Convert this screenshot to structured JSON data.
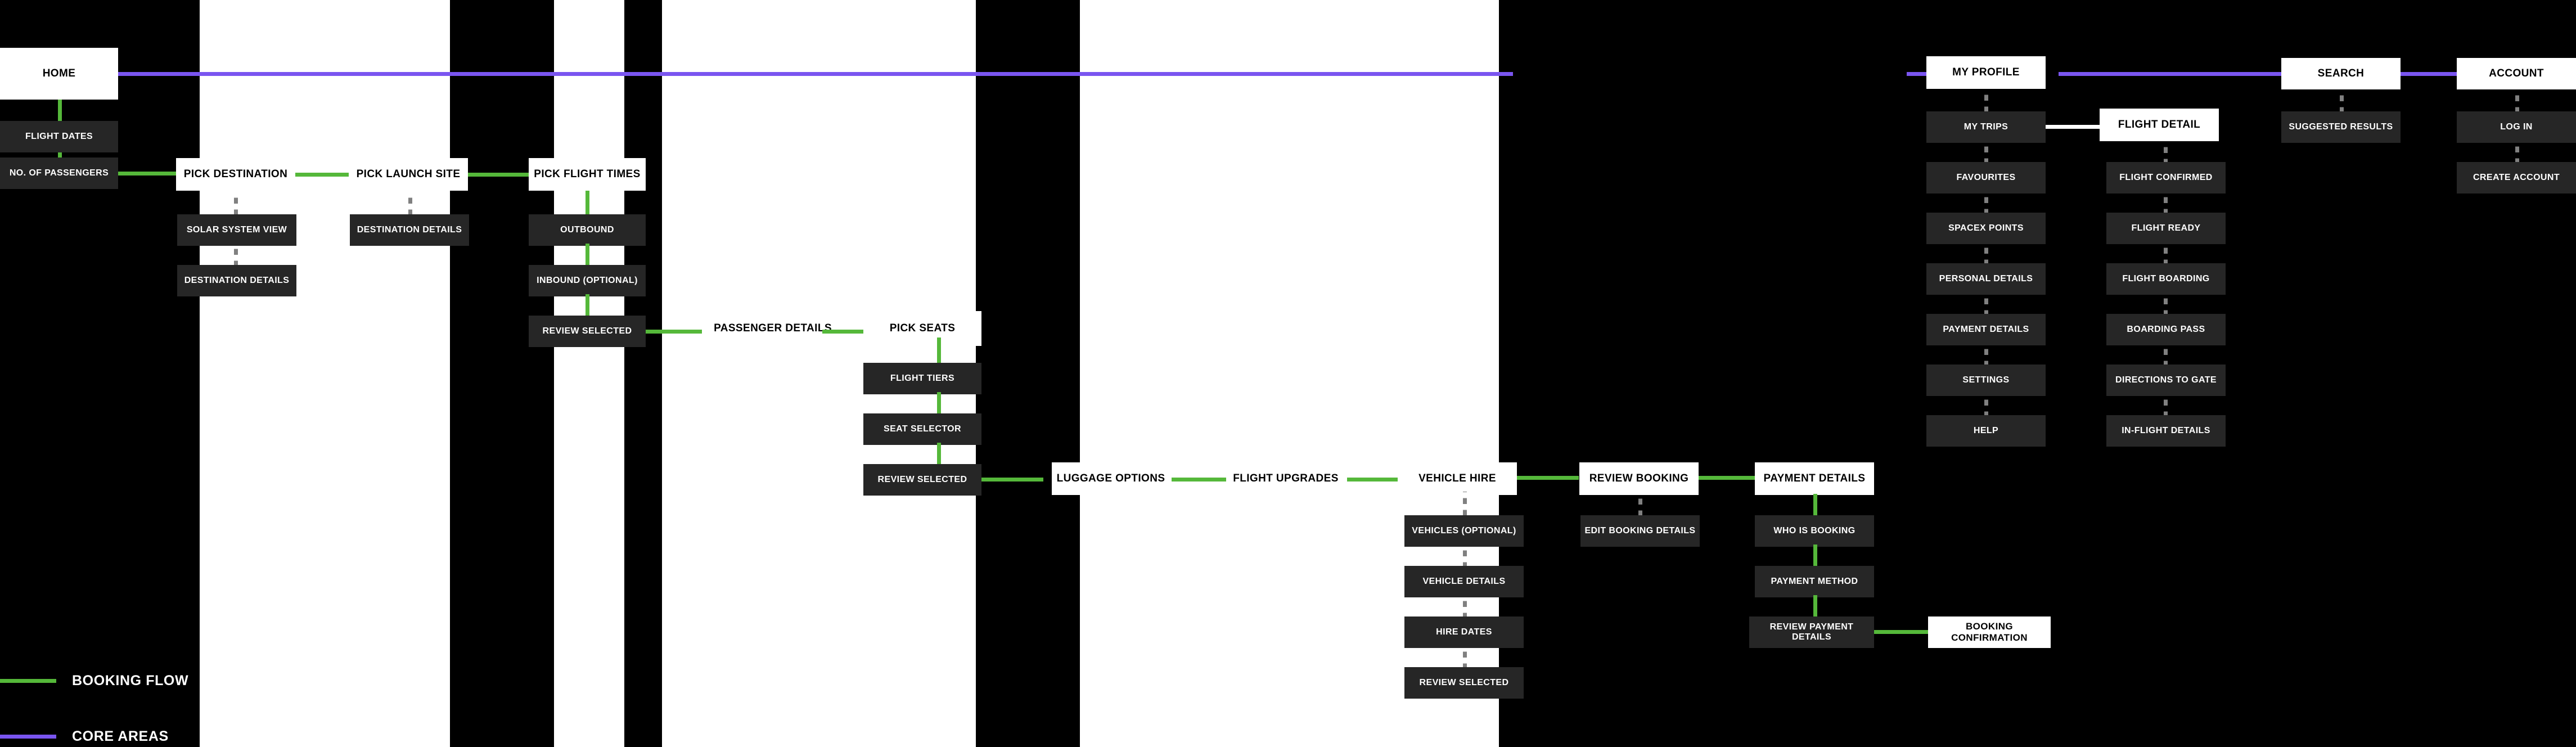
{
  "meta": {
    "title": "Space Travel Booking — Site Map / User Flow",
    "colors": {
      "booking_flow": "#55b83a",
      "core_areas": "#7a55f0",
      "node_primary_bg": "#ffffff",
      "node_sub_bg": "#262626",
      "canvas_bg": "#000000",
      "stripe_bg": "#ffffff",
      "dotted_connector": "#808080",
      "plain_connector": "#ffffff"
    }
  },
  "legend": {
    "items": [
      {
        "label": "BOOKING FLOW",
        "color": "#55b83a"
      },
      {
        "label": "CORE AREAS",
        "color": "#7a55f0"
      }
    ]
  },
  "flow": {
    "primary_nodes": [
      {
        "id": "home",
        "label": "HOME"
      },
      {
        "id": "pick-destination",
        "label": "PICK DESTINATION"
      },
      {
        "id": "pick-launch-site",
        "label": "PICK LAUNCH SITE"
      },
      {
        "id": "pick-flight-times",
        "label": "PICK FLIGHT TIMES"
      },
      {
        "id": "passenger-details",
        "label": "PASSENGER DETAILS"
      },
      {
        "id": "pick-seats",
        "label": "PICK SEATS"
      },
      {
        "id": "luggage-options",
        "label": "LUGGAGE OPTIONS"
      },
      {
        "id": "flight-upgrades",
        "label": "FLIGHT UPGRADES"
      },
      {
        "id": "vehicle-hire",
        "label": "VEHICLE HIRE"
      },
      {
        "id": "review-booking",
        "label": "REVIEW BOOKING"
      },
      {
        "id": "payment-details",
        "label": "PAYMENT DETAILS"
      },
      {
        "id": "booking-confirmation",
        "label": "BOOKING CONFIRMATION"
      },
      {
        "id": "my-profile",
        "label": "MY PROFILE"
      },
      {
        "id": "flight-detail",
        "label": "FLIGHT DETAIL"
      },
      {
        "id": "search",
        "label": "SEARCH"
      },
      {
        "id": "account",
        "label": "ACCOUNT"
      }
    ],
    "sub_nodes": {
      "home": [
        "FLIGHT DATES",
        "NO. OF PASSENGERS"
      ],
      "pick_destination": [
        "SOLAR SYSTEM VIEW",
        "DESTINATION DETAILS"
      ],
      "pick_launch_site": [
        "DESTINATION DETAILS"
      ],
      "pick_flight_times": [
        "OUTBOUND",
        "INBOUND (OPTIONAL)",
        "REVIEW SELECTED"
      ],
      "pick_seats": [
        "FLIGHT TIERS",
        "SEAT SELECTOR",
        "REVIEW SELECTED"
      ],
      "vehicle_hire": [
        "VEHICLES (OPTIONAL)",
        "VEHICLE DETAILS",
        "HIRE DATES",
        "REVIEW SELECTED"
      ],
      "review_booking": [
        "EDIT BOOKING DETAILS"
      ],
      "payment_details": [
        "WHO IS BOOKING",
        "PAYMENT METHOD",
        "REVIEW PAYMENT DETAILS"
      ],
      "my_profile": [
        "MY TRIPS",
        "FAVOURITES",
        "SPACEX POINTS",
        "PERSONAL DETAILS",
        "PAYMENT DETAILS",
        "SETTINGS",
        "HELP"
      ],
      "flight_detail": [
        "FLIGHT CONFIRMED",
        "FLIGHT READY",
        "FLIGHT BOARDING",
        "BOARDING PASS",
        "DIRECTIONS TO GATE",
        "IN-FLIGHT DETAILS"
      ],
      "search": [
        "SUGGESTED RESULTS"
      ],
      "account": [
        "LOG IN",
        "CREATE ACCOUNT"
      ]
    }
  }
}
